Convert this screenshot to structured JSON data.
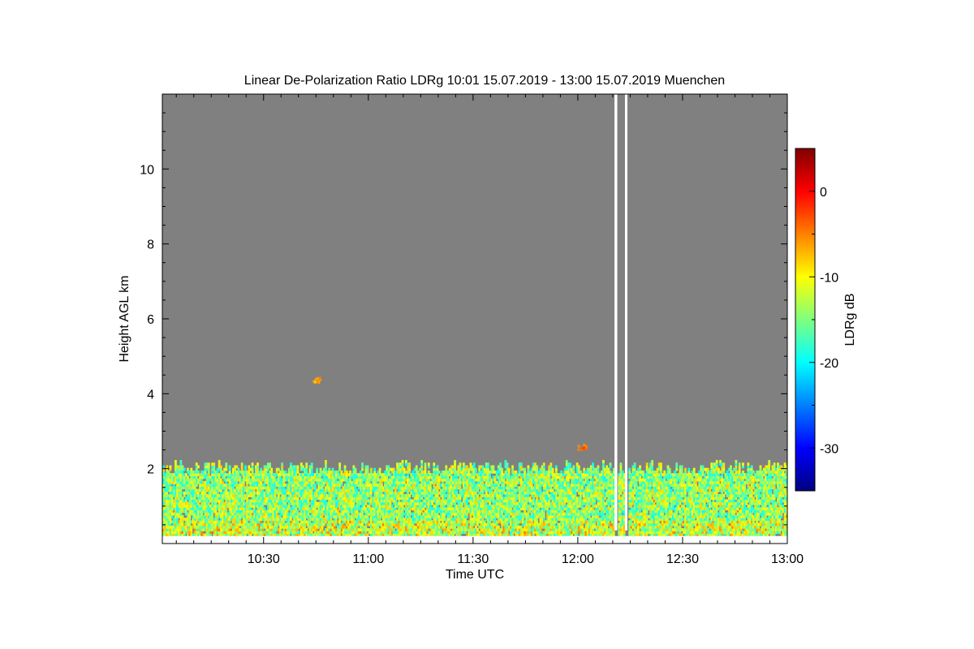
{
  "chart_data": {
    "type": "heatmap",
    "title": "Linear De-Polarization Ratio LDRg   10:01 15.07.2019 - 13:00 15.07.2019 Muenchen",
    "xlabel": "Time UTC",
    "ylabel": "Height AGL km",
    "x_range_minutes_utc": [
      601,
      780
    ],
    "x_ticks": [
      "10:30",
      "11:00",
      "11:30",
      "12:00",
      "12:30",
      "13:00"
    ],
    "x_tick_minutes": [
      630,
      660,
      690,
      720,
      750,
      780
    ],
    "ylim": [
      0,
      12
    ],
    "y_ticks": [
      2,
      4,
      6,
      8,
      10
    ],
    "background_color": "#808080",
    "colorbar": {
      "label": "LDRg dB",
      "range": [
        -35,
        5
      ],
      "ticks": [
        0,
        -10,
        -20,
        -30
      ],
      "colormap": [
        "#000080",
        "#0000ff",
        "#00ffff",
        "#ffff00",
        "#ff8000",
        "#ff0000",
        "#800000"
      ]
    },
    "boundary_layer": {
      "top_height_km": 2.0,
      "bottom_height_km": 0.2,
      "typical_ldr_db": -14
    },
    "data_gaps_minutes_utc": [
      [
        730.5,
        731.3
      ],
      [
        733.5,
        734.2
      ]
    ],
    "elevated_features": [
      {
        "time_minutes": 721,
        "height_km": 2.6,
        "ldr_db": -4
      },
      {
        "time_minutes": 645,
        "height_km": 4.4,
        "ldr_db": -6
      }
    ]
  }
}
